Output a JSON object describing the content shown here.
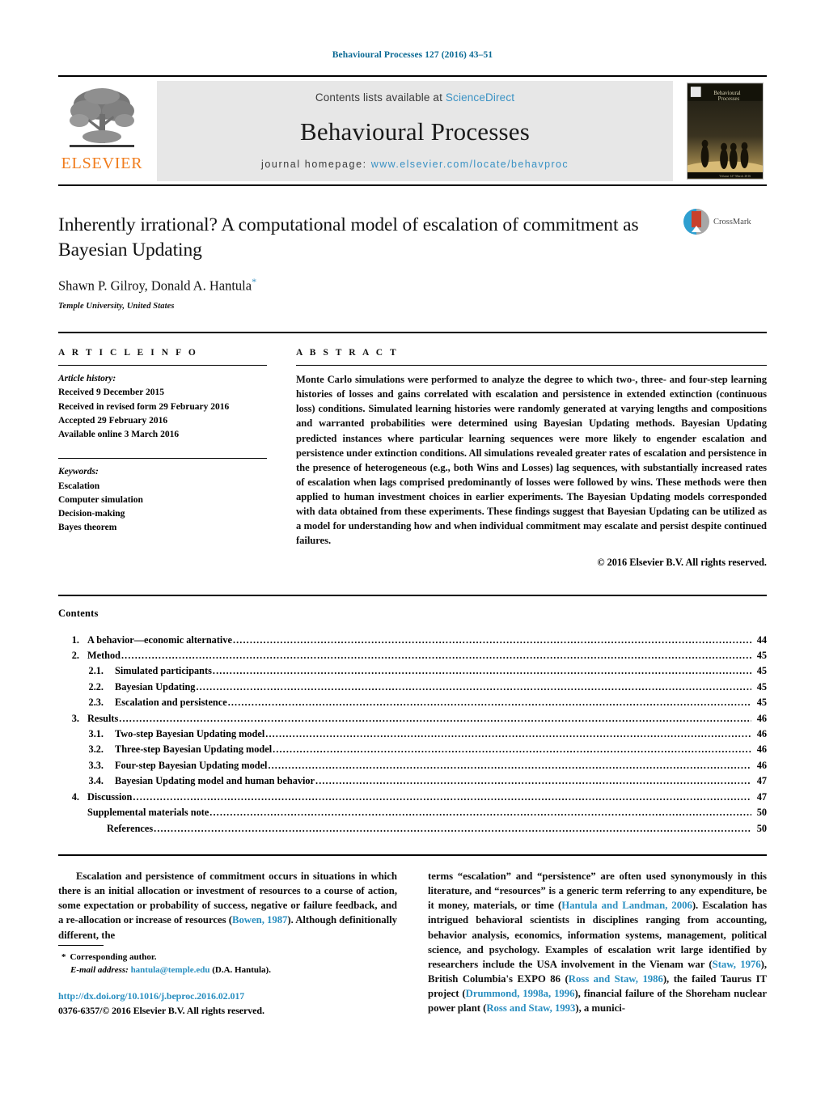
{
  "running_head": "Behavioural Processes 127 (2016) 43–51",
  "masthead": {
    "publisher_logo_text": "ELSEVIER",
    "contents_prefix": "Contents lists available at ",
    "contents_link": "ScienceDirect",
    "journal_name": "Behavioural Processes",
    "homepage_prefix": "journal homepage: ",
    "homepage_url": "www.elsevier.com/locate/behavproc",
    "cover_caption": "Behavioural Processes"
  },
  "article": {
    "title": "Inherently irrational? A computational model of escalation of commitment as Bayesian Updating",
    "authors": "Shawn P. Gilroy, Donald A. Hantula",
    "corresponding_marker": "*",
    "affiliation": "Temple University, United States",
    "crossmark_label": "CrossMark"
  },
  "info": {
    "section_label": "A R T I C L E   I N F O",
    "history_label": "Article history:",
    "history": [
      "Received 9 December 2015",
      "Received in revised form 29 February 2016",
      "Accepted 29 February 2016",
      "Available online 3 March 2016"
    ],
    "keywords_label": "Keywords:",
    "keywords": [
      "Escalation",
      "Computer simulation",
      "Decision-making",
      "Bayes theorem"
    ]
  },
  "abstract": {
    "section_label": "A B S T R A C T",
    "text": "Monte Carlo simulations were performed to analyze the degree to which two-, three- and four-step learning histories of losses and gains correlated with escalation and persistence in extended extinction (continuous loss) conditions. Simulated learning histories were randomly generated at varying lengths and compositions and warranted probabilities were determined using Bayesian Updating methods. Bayesian Updating predicted instances where particular learning sequences were more likely to engender escalation and persistence under extinction conditions. All simulations revealed greater rates of escalation and persistence in the presence of heterogeneous (e.g., both Wins and Losses) lag sequences, with substantially increased rates of escalation when lags comprised predominantly of losses were followed by wins. These methods were then applied to human investment choices in earlier experiments. The Bayesian Updating models corresponded with data obtained from these experiments. These findings suggest that Bayesian Updating can be utilized as a model for understanding how and when individual commitment may escalate and persist despite continued failures.",
    "copyright": "© 2016 Elsevier B.V. All rights reserved."
  },
  "contents": {
    "heading": "Contents",
    "entries": [
      {
        "number": "1.",
        "label": "A behavior—economic alternative",
        "page": "44",
        "level": 1
      },
      {
        "number": "2.",
        "label": "Method",
        "page": "45",
        "level": 1
      },
      {
        "number": "2.1.",
        "label": "Simulated participants",
        "page": "45",
        "level": 2
      },
      {
        "number": "2.2.",
        "label": "Bayesian Updating",
        "page": "45",
        "level": 2
      },
      {
        "number": "2.3.",
        "label": "Escalation and persistence",
        "page": "45",
        "level": 2
      },
      {
        "number": "3.",
        "label": "Results",
        "page": "46",
        "level": 1
      },
      {
        "number": "3.1.",
        "label": "Two-step Bayesian Updating model",
        "page": "46",
        "level": 2
      },
      {
        "number": "3.2.",
        "label": "Three-step Bayesian Updating model",
        "page": "46",
        "level": 2
      },
      {
        "number": "3.3.",
        "label": "Four-step Bayesian Updating model",
        "page": "46",
        "level": 2
      },
      {
        "number": "3.4.",
        "label": "Bayesian Updating model and human behavior",
        "page": "47",
        "level": 2
      },
      {
        "number": "4.",
        "label": "Discussion",
        "page": "47",
        "level": 1
      },
      {
        "number": "",
        "label": "Supplemental materials note",
        "page": "50",
        "level": 1
      },
      {
        "number": "",
        "label": "References",
        "page": "50",
        "level": 2
      }
    ]
  },
  "body": {
    "left_column": {
      "segments": [
        {
          "text": "Escalation and persistence of commitment occurs in situations in which there is an initial allocation or investment of resources to a course of action, some expectation or probability of success, negative or failure feedback, and a re-allocation or increase of resources (",
          "link": false
        },
        {
          "text": "Bowen, 1987",
          "link": true
        },
        {
          "text": "). Although definitionally different, the",
          "link": false
        }
      ]
    },
    "right_column": {
      "segments": [
        {
          "text": "terms “escalation” and “persistence” are often used synonymously in this literature, and “resources” is a generic term referring to any expenditure, be it money, materials, or time (",
          "link": false
        },
        {
          "text": "Hantula and Landman, 2006",
          "link": true
        },
        {
          "text": "). Escalation has intrigued behavioral scientists in disciplines ranging from accounting, behavior analysis, economics, information systems, management, political science, and psychology. Examples of escalation writ large identified by researchers include the USA involvement in the Vienam war (",
          "link": false
        },
        {
          "text": "Staw, 1976",
          "link": true
        },
        {
          "text": "), British Columbia's EXPO 86 (",
          "link": false
        },
        {
          "text": "Ross and Staw, 1986",
          "link": true
        },
        {
          "text": "), the failed Taurus IT project (",
          "link": false
        },
        {
          "text": "Drummond, 1998a, 1996",
          "link": true
        },
        {
          "text": "), financial failure of the Shoreham nuclear power plant (",
          "link": false
        },
        {
          "text": "Ross and Staw, 1993",
          "link": true
        },
        {
          "text": "), a munici-",
          "link": false
        }
      ]
    }
  },
  "footnote": {
    "star": "*",
    "corresponding": "Corresponding author.",
    "email_label": "E-mail address:",
    "email": "hantula@temple.edu",
    "email_suffix": "(D.A. Hantula)."
  },
  "footer": {
    "doi": "http://dx.doi.org/10.1016/j.beproc.2016.02.017",
    "issn": "0376-6357/© 2016 Elsevier B.V. All rights reserved."
  },
  "colors": {
    "link_blue": "#2a8fc0",
    "header_teal": "#0b6a94",
    "elsevier_orange": "#f07c1c",
    "band_gray": "#e7e7e7"
  }
}
